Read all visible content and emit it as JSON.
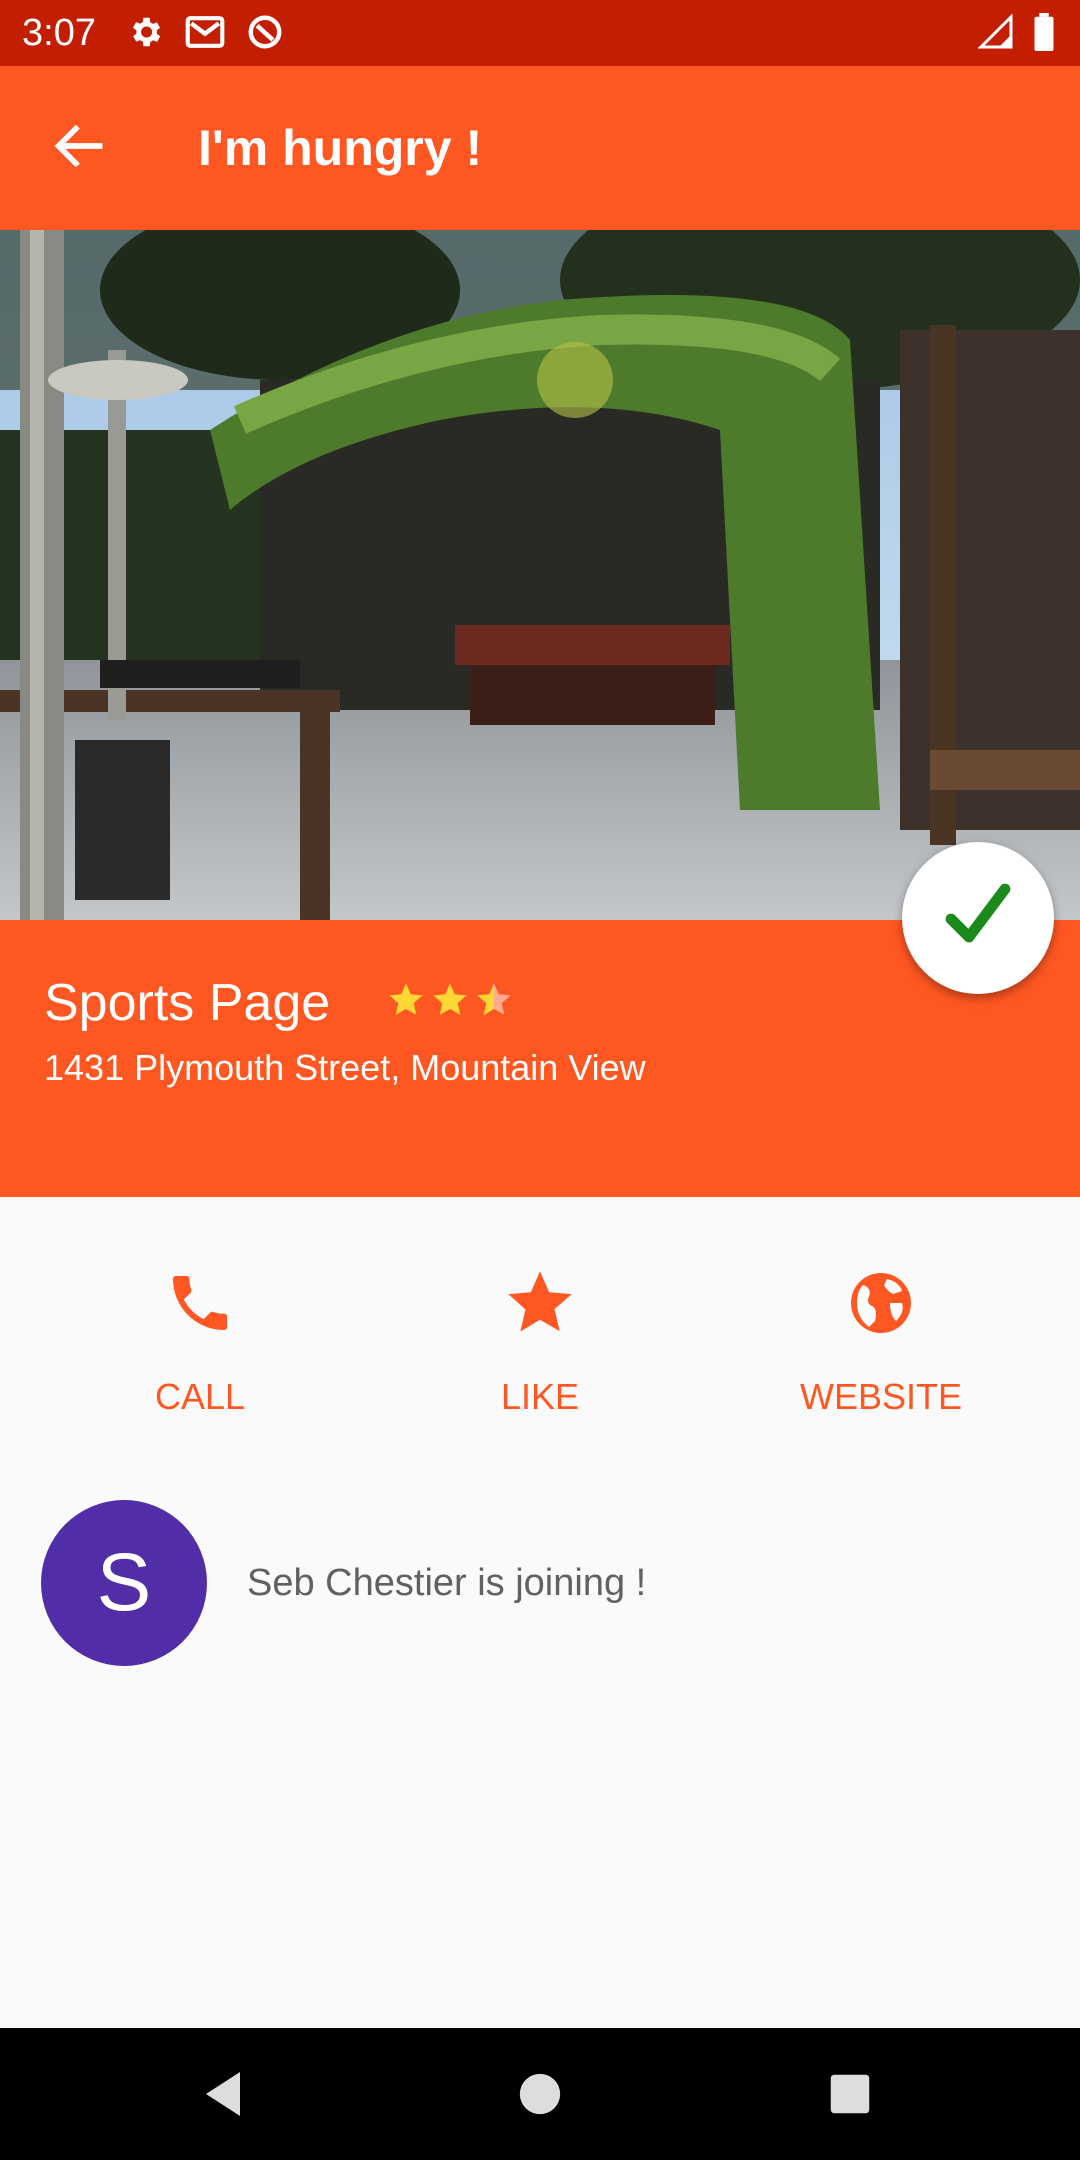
{
  "status_bar": {
    "time": "3:07",
    "icons": [
      "settings-icon",
      "gmail-icon",
      "sync-icon",
      "signal-icon",
      "battery-icon"
    ]
  },
  "app_bar": {
    "title": "I'm hungry !",
    "back_icon": "back-arrow-icon"
  },
  "place": {
    "name": "Sports Page",
    "address": "1431 Plymouth Street, Mountain View",
    "rating": 2.5,
    "rating_max": 3
  },
  "actions": [
    {
      "label": "CALL",
      "icon": "phone-icon"
    },
    {
      "label": "LIKE",
      "icon": "star-icon"
    },
    {
      "label": "WEBSITE",
      "icon": "globe-icon"
    }
  ],
  "joining": {
    "avatar_letter": "S",
    "text": "Seb Chestier is joining !"
  },
  "colors": {
    "status_bar": "#c41e00",
    "primary": "#ff5722",
    "avatar": "#512da8",
    "check": "#1a8a1a",
    "star": "#fdd835"
  }
}
